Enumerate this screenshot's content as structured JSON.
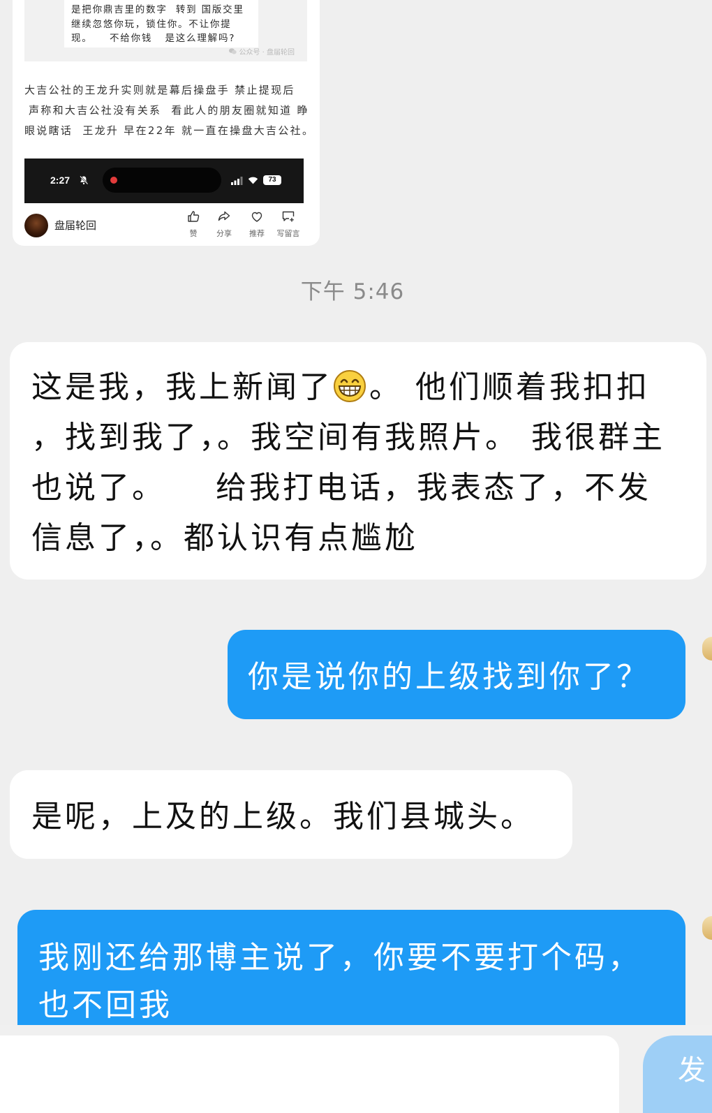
{
  "shared_article": {
    "quote_lines": [
      "是把你鼎吉里的数字  转到 国版交里",
      "继续忽悠你玩，锁住你。不让你提",
      "现。    不给你钱   是这么理解吗?"
    ],
    "watermark": "公众号 · 盘届轮回",
    "paragraph_lines": [
      "大吉公社的王龙升实则就是幕后操盘手 禁止提现后",
      "声称和大吉公社没有关系  看此人的朋友圈就知道 睁",
      "眼说瞎话  王龙升 早在22年 就一直在操盘大吉公社。"
    ],
    "phone_status": {
      "time": "2:27",
      "battery": "73"
    },
    "account_name": "盘届轮回",
    "actions": [
      {
        "icon": "thumbs-up-icon",
        "label": "赞"
      },
      {
        "icon": "share-icon",
        "label": "分享"
      },
      {
        "icon": "heart-icon",
        "label": "推荐"
      },
      {
        "icon": "comment-icon",
        "label": "写留言"
      }
    ]
  },
  "timestamp": "下午 5:46",
  "messages": [
    {
      "outgoing": false,
      "text_before_emoji": "这是我，我上新闻了",
      "emoji": "grinning-face-icon",
      "text_after_emoji": "。 他们顺着我扣扣，找到我了，。我空间有我照片。 我很群主也说了。    给我打电话，我表态了，不发信息了，。都认识有点尴尬"
    },
    {
      "outgoing": true,
      "text": "你是说你的上级找到你了？"
    },
    {
      "outgoing": false,
      "text": "是呢，上及的上级。我们县城头。"
    },
    {
      "outgoing": true,
      "text": "我刚还给那博主说了，你要不要打个码，也不回我"
    }
  ],
  "composer": {
    "send_label": "发"
  },
  "colors": {
    "background": "#efefef",
    "incoming_bubble": "#ffffff",
    "outgoing_bubble": "#1e9bf6",
    "send_button": "#9ecff6",
    "timestamp": "#8a8a8a"
  }
}
